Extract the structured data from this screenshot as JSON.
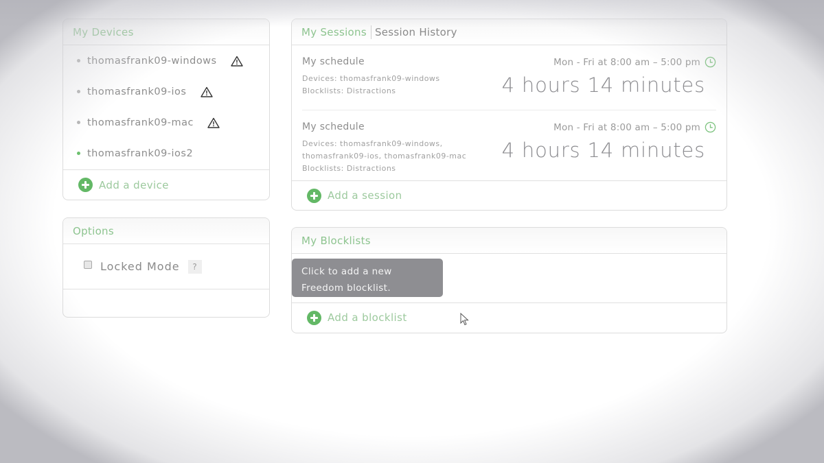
{
  "devices": {
    "title": "My Devices",
    "items": [
      {
        "name": "thomasfrank09-windows",
        "status": "offline",
        "warning": true,
        "icon": "warning-icon"
      },
      {
        "name": "thomasfrank09-ios",
        "status": "offline",
        "warning": true,
        "icon": "warning-icon"
      },
      {
        "name": "thomasfrank09-mac",
        "status": "offline",
        "warning": true,
        "icon": "warning-icon"
      },
      {
        "name": "thomasfrank09-ios2",
        "status": "online",
        "warning": false
      }
    ],
    "add_label": "Add a device"
  },
  "options": {
    "title": "Options",
    "locked_mode": {
      "label": "Locked Mode",
      "checked": false,
      "help": "?"
    }
  },
  "sessions": {
    "tabs": [
      {
        "label": "My Sessions",
        "active": true
      },
      {
        "label": "Session History",
        "active": false
      }
    ],
    "items": [
      {
        "title": "My schedule",
        "devices": "Devices: thomasfrank09-windows",
        "devices_cont": "",
        "blocklists": "Blocklists: Distractions",
        "schedule": "Mon - Fri at 8:00 am – 5:00 pm",
        "duration": "4 hours 14 minutes"
      },
      {
        "title": "My schedule",
        "devices": "Devices: thomasfrank09-windows,",
        "devices_cont": "thomasfrank09-ios, thomasfrank09-mac",
        "blocklists": "Blocklists: Distractions",
        "schedule": "Mon - Fri at 8:00 am – 5:00 pm",
        "duration": "4 hours 14 minutes"
      }
    ],
    "add_label": "Add a session"
  },
  "blocklists": {
    "title": "My Blocklists",
    "tooltip_line1": "Click to add a new",
    "tooltip_line2": "Freedom blocklist.",
    "add_label": "Add a blocklist"
  },
  "colors": {
    "accent": "#63b866",
    "accent_text": "#8dc48f",
    "tooltip_bg": "#8e8e92"
  }
}
